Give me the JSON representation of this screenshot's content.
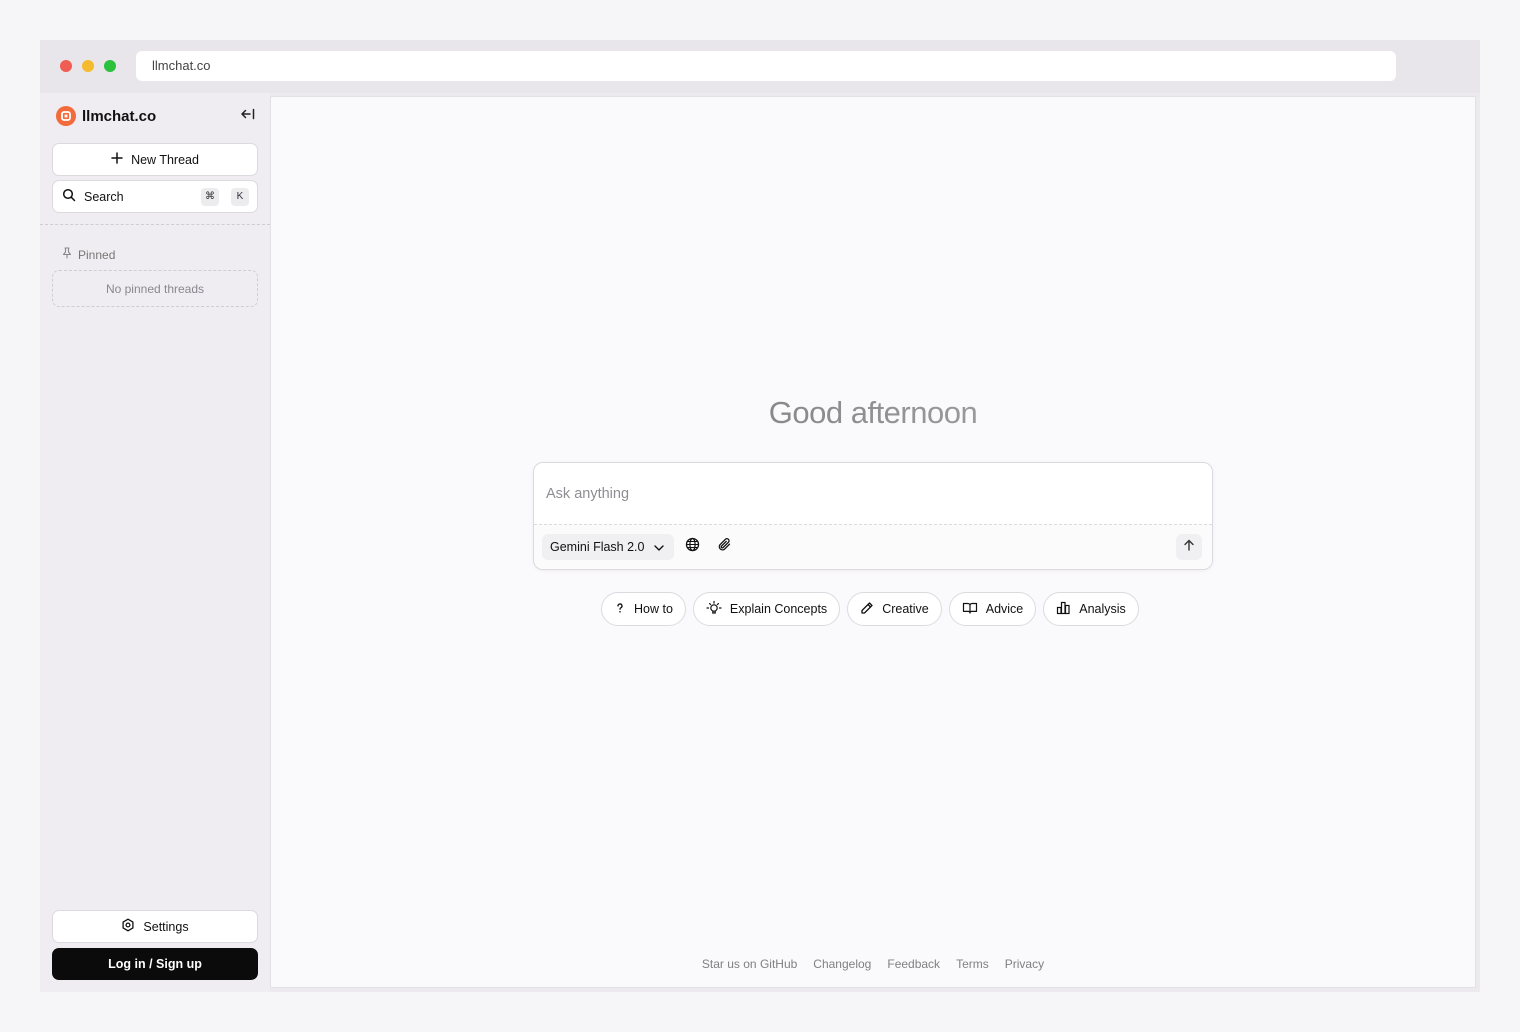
{
  "browser": {
    "url": "llmchat.co"
  },
  "sidebar": {
    "brand": "llmchat.co",
    "new_thread_label": "New Thread",
    "search": {
      "label": "Search",
      "shortcut_mod": "⌘",
      "shortcut_key": "K"
    },
    "pinned": {
      "label": "Pinned",
      "empty_text": "No pinned threads"
    },
    "settings_label": "Settings",
    "login_label": "Log in / Sign up"
  },
  "main": {
    "greeting": "Good afternoon",
    "composer": {
      "placeholder": "Ask anything",
      "model": "Gemini Flash 2.0"
    },
    "chips": [
      {
        "label": "How to",
        "icon": "question-icon"
      },
      {
        "label": "Explain Concepts",
        "icon": "lightbulb-icon"
      },
      {
        "label": "Creative",
        "icon": "pencil-icon"
      },
      {
        "label": "Advice",
        "icon": "book-icon"
      },
      {
        "label": "Analysis",
        "icon": "bar-chart-icon"
      }
    ],
    "footer_links": [
      "Star us on GitHub",
      "Changelog",
      "Feedback",
      "Terms",
      "Privacy"
    ]
  },
  "colors": {
    "brand": "#f26b3a",
    "login_button": "#0b0b0b",
    "traffic_red": "#ef5d53",
    "traffic_yellow": "#f5bb2f",
    "traffic_green": "#2bc13c"
  }
}
